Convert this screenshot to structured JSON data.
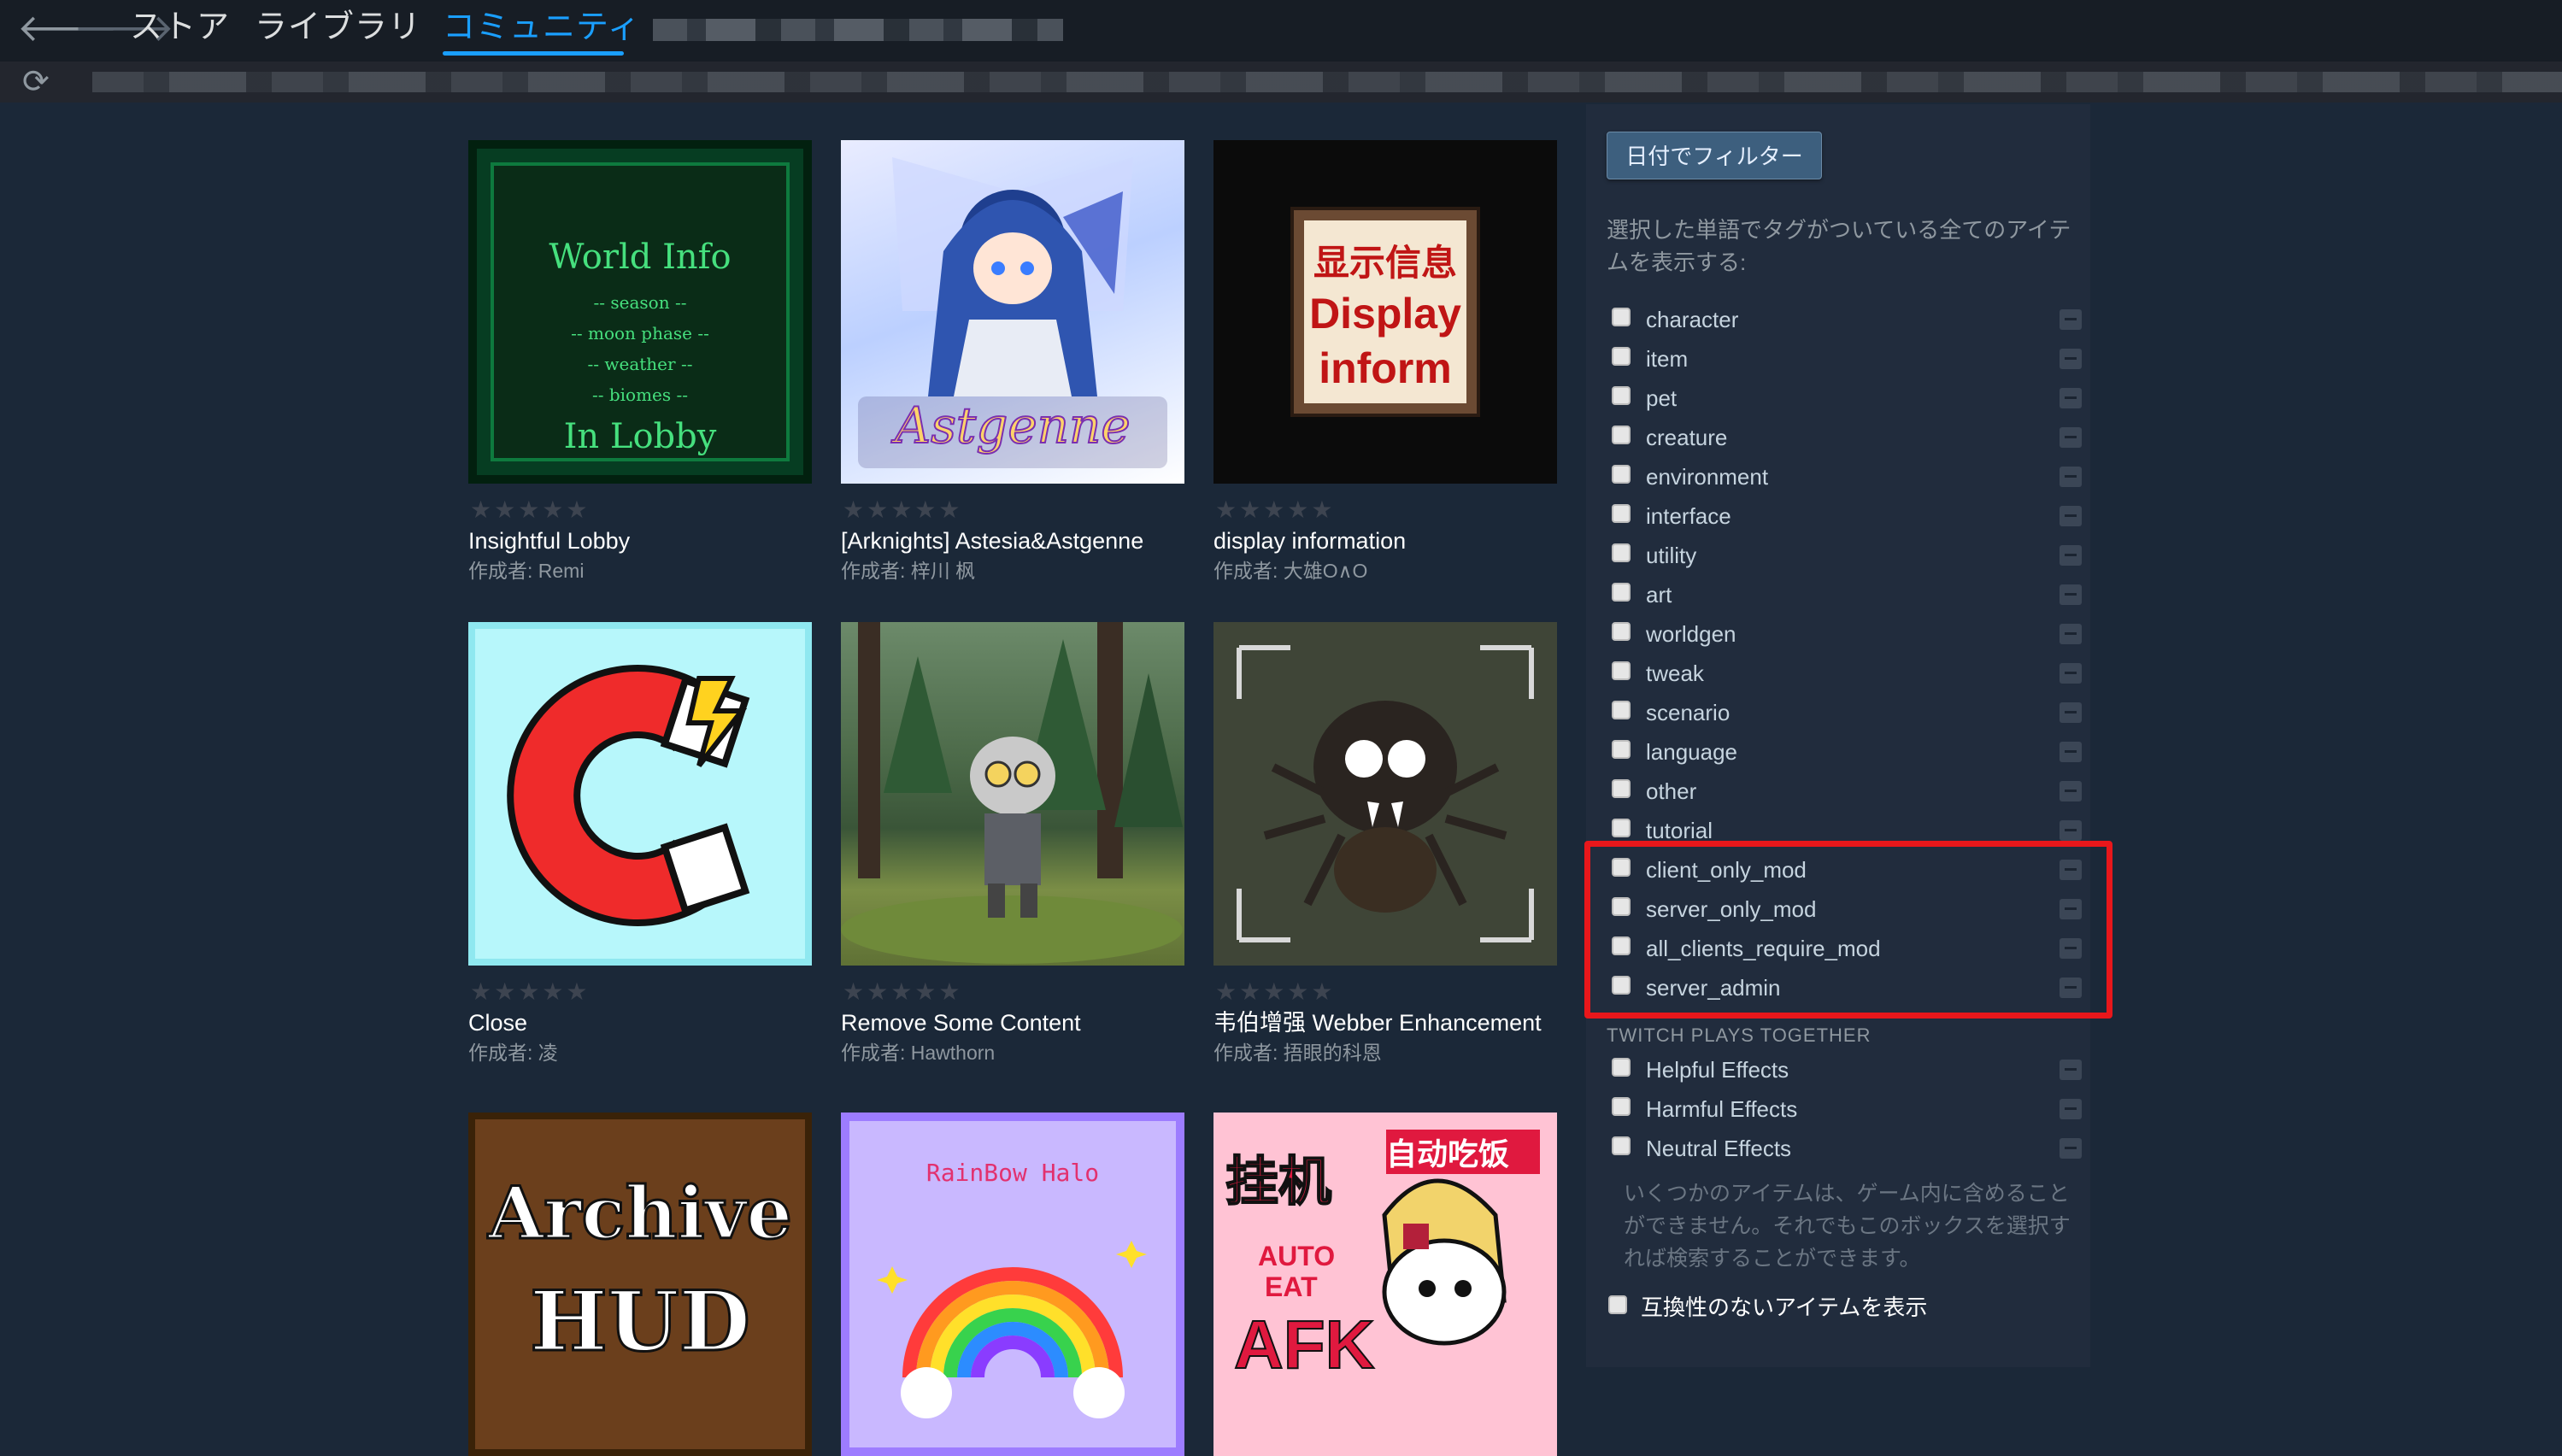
{
  "nav": {
    "back_icon": "arrow-left-icon",
    "forward_icon": "arrow-right-icon",
    "tabs": [
      {
        "label": "ストア"
      },
      {
        "label": "ライブラリ"
      },
      {
        "label": "コミュニティ",
        "active": true
      }
    ]
  },
  "urlbar": {
    "refresh_icon": "refresh-icon"
  },
  "items": [
    {
      "title": "Insightful Lobby",
      "author": "作成者: Remi",
      "thumb": {
        "lines": [
          "World Info",
          "-- season --",
          "-- moon phase --",
          "-- weather --",
          "-- biomes --",
          "In Lobby"
        ]
      }
    },
    {
      "title": "[Arknights] Astesia&Astgenne",
      "author": "作成者: 梓川 枫",
      "thumb": {
        "text": "Astgenne"
      }
    },
    {
      "title": "display information",
      "author": "作成者: 大雄O∧O",
      "thumb": {
        "lines": [
          "显示信息",
          "Display",
          "inform"
        ]
      }
    },
    {
      "title": "Close",
      "author": "作成者: 凌"
    },
    {
      "title": "Remove Some Content",
      "author": "作成者: Hawthorn"
    },
    {
      "title": "韦伯增强 Webber Enhancement",
      "author": "作成者: 捂眼的科恩"
    },
    {
      "title": "",
      "author": "",
      "thumb": {
        "lines": [
          "Archive",
          "HUD"
        ]
      }
    },
    {
      "title": "",
      "author": "",
      "thumb": {
        "text": "RainBow Halo"
      }
    },
    {
      "title": "",
      "author": "",
      "thumb": {
        "lines": [
          "挂机",
          "自动吃饭",
          "AUTO",
          "EAT",
          "AFK"
        ]
      }
    }
  ],
  "rating_stars": "★★★★★",
  "sidebar": {
    "filter_button": "日付でフィルター",
    "instructions": "選択した単語でタグがついている全てのアイテムを表示する:",
    "tags": [
      "character",
      "item",
      "pet",
      "creature",
      "environment",
      "interface",
      "utility",
      "art",
      "worldgen",
      "tweak",
      "scenario",
      "language",
      "other",
      "tutorial",
      "client_only_mod",
      "server_only_mod",
      "all_clients_require_mod",
      "server_admin"
    ],
    "twitch_heading": "TWITCH PLAYS TOGETHER",
    "twitch_tags": [
      "Helpful Effects",
      "Harmful Effects",
      "Neutral Effects"
    ],
    "incompat_note": "いくつかのアイテムは、ゲーム内に含めることができません。それでもこのボックスを選択すれば検索することができます。",
    "incompat_label": "互換性のないアイテムを表示"
  },
  "highlight_color": "#e8171b",
  "accent_color": "#1a9fff"
}
